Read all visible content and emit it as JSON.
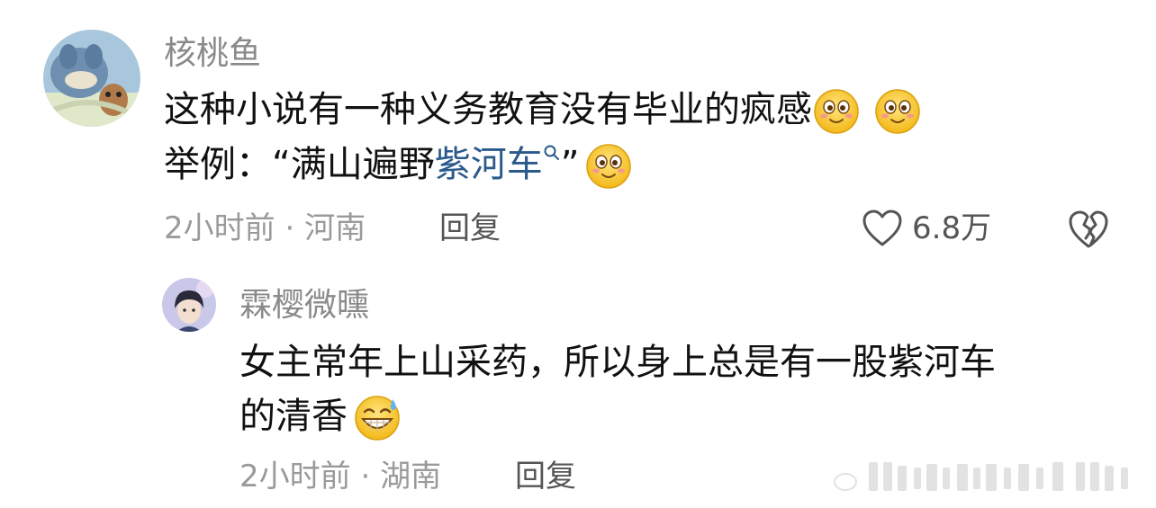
{
  "comment": {
    "username": "核桃鱼",
    "line1": "这种小说有一种义务教育没有毕业的疯感",
    "line2_prefix": "举例：“满山遍野",
    "line2_link": "紫河车",
    "line2_suffix": "”",
    "time": "2小时前",
    "separator": "·",
    "location": "河南",
    "reply_label": "回复",
    "like_count": "6.8万",
    "icons": {
      "avatar": "tom-and-jerry-avatar",
      "emoji": "grinning-face-emoji",
      "like": "heart-outline-icon",
      "dislike": "broken-heart-icon",
      "search": "search-icon"
    }
  },
  "reply": {
    "username": "霖樱微曛",
    "line1": "女主常年上山采药，所以身上总是有一股紫河车",
    "line2": "的清香",
    "time": "2小时前",
    "separator": "·",
    "location": "湖南",
    "reply_label": "回复",
    "icons": {
      "avatar": "anime-boy-avatar",
      "emoji": "grinning-sweat-emoji"
    }
  },
  "colors": {
    "username": "#8a8a8a",
    "link": "#2b5a8a",
    "meta": "#9a9a9a"
  }
}
